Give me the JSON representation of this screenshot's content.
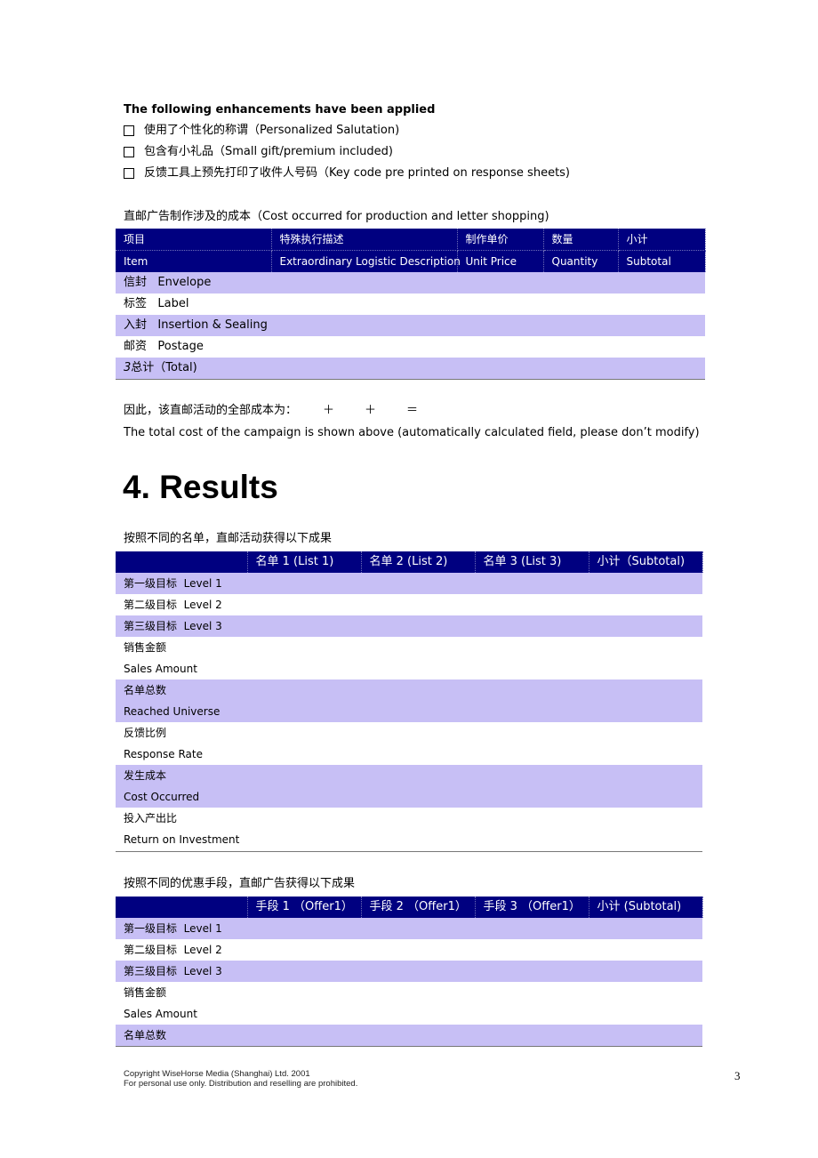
{
  "enhancements": {
    "heading": "The following enhancements have been applied",
    "options": [
      {
        "label": "使用了个性化的称谓（Personalized Salutation)",
        "checked": false
      },
      {
        "label": "包含有小礼品（Small gift/premium included)",
        "checked": false
      },
      {
        "label": "反馈工具上预先打印了收件人号码（Key code pre printed on response sheets)",
        "checked": false
      }
    ]
  },
  "cost_table": {
    "caption": "直邮广告制作涉及的成本（Cost occurred for production and letter shopping)",
    "headers_cn": [
      "项目",
      "特殊执行描述",
      "制作单价",
      "数量",
      "小计"
    ],
    "headers_en": [
      "Item",
      "Extraordinary Logistic Description",
      "Unit Price",
      "Quantity",
      "Subtotal"
    ],
    "rows": [
      {
        "item": "信封   Envelope",
        "description": "",
        "unit_price": "",
        "quantity": "",
        "subtotal": ""
      },
      {
        "item": "标签   Label",
        "description": "",
        "unit_price": "",
        "quantity": "",
        "subtotal": ""
      },
      {
        "item": "入封   Insertion & Sealing",
        "description": "",
        "unit_price": "",
        "quantity": "",
        "subtotal": ""
      },
      {
        "item": "邮资   Postage",
        "description": "",
        "unit_price": "",
        "quantity": "",
        "subtotal": ""
      },
      {
        "item_prefix": "3",
        "item": "总计（Total)",
        "description": "",
        "unit_price": "",
        "quantity": "",
        "subtotal": ""
      }
    ]
  },
  "total_cost": {
    "label_cn": "因此，该直邮活动的全部成本为：",
    "operators": [
      "＋",
      "＋",
      "＝"
    ],
    "note": "The total cost of the campaign is shown above (automatically calculated field, please don’t modify)"
  },
  "section": {
    "title": "4. Results"
  },
  "results_by_list": {
    "caption": "按照不同的名单，直邮活动获得以下成果",
    "headers": [
      "",
      "名单 1 (List 1)",
      "名单 2 (List 2)",
      "名单 3 (List 3)",
      "小计（Subtotal)"
    ],
    "rows": [
      {
        "label": "第一级目标  Level 1",
        "shade": true
      },
      {
        "label": "第二级目标  Level 2",
        "shade": false
      },
      {
        "label": "第三级目标  Level 3",
        "shade": true
      },
      {
        "label": "销售金额",
        "shade": false
      },
      {
        "label": "Sales Amount",
        "shade": false
      },
      {
        "label": "名单总数",
        "shade": true
      },
      {
        "label": "Reached Universe",
        "shade": true
      },
      {
        "label": "反馈比例",
        "shade": false
      },
      {
        "label": "Response Rate",
        "shade": false
      },
      {
        "label": "发生成本",
        "shade": true
      },
      {
        "label": "Cost Occurred",
        "shade": true
      },
      {
        "label": "投入产出比",
        "shade": false
      },
      {
        "label": "Return on Investment",
        "shade": false
      }
    ]
  },
  "results_by_offer": {
    "caption": "按照不同的优惠手段，直邮广告获得以下成果",
    "headers": [
      "",
      "手段 1 （Offer1）",
      "手段 2 （Offer1）",
      "手段 3 （Offer1）",
      "小计 (Subtotal)"
    ],
    "rows": [
      {
        "label": "第一级目标  Level 1",
        "shade": true
      },
      {
        "label": "第二级目标  Level 2",
        "shade": false
      },
      {
        "label": "第三级目标  Level 3",
        "shade": true
      },
      {
        "label": "销售金额",
        "shade": false
      },
      {
        "label": "Sales Amount",
        "shade": false
      },
      {
        "label": "名单总数",
        "shade": true
      }
    ]
  },
  "footer": {
    "line1": "Copyright WiseHorse Media (Shanghai) Ltd. 2001",
    "line2": "For personal use only. Distribution and reselling are prohibited.",
    "page_number": "3"
  },
  "colors": {
    "header_bg": "#000080",
    "row_shade": "#c7bff5"
  }
}
